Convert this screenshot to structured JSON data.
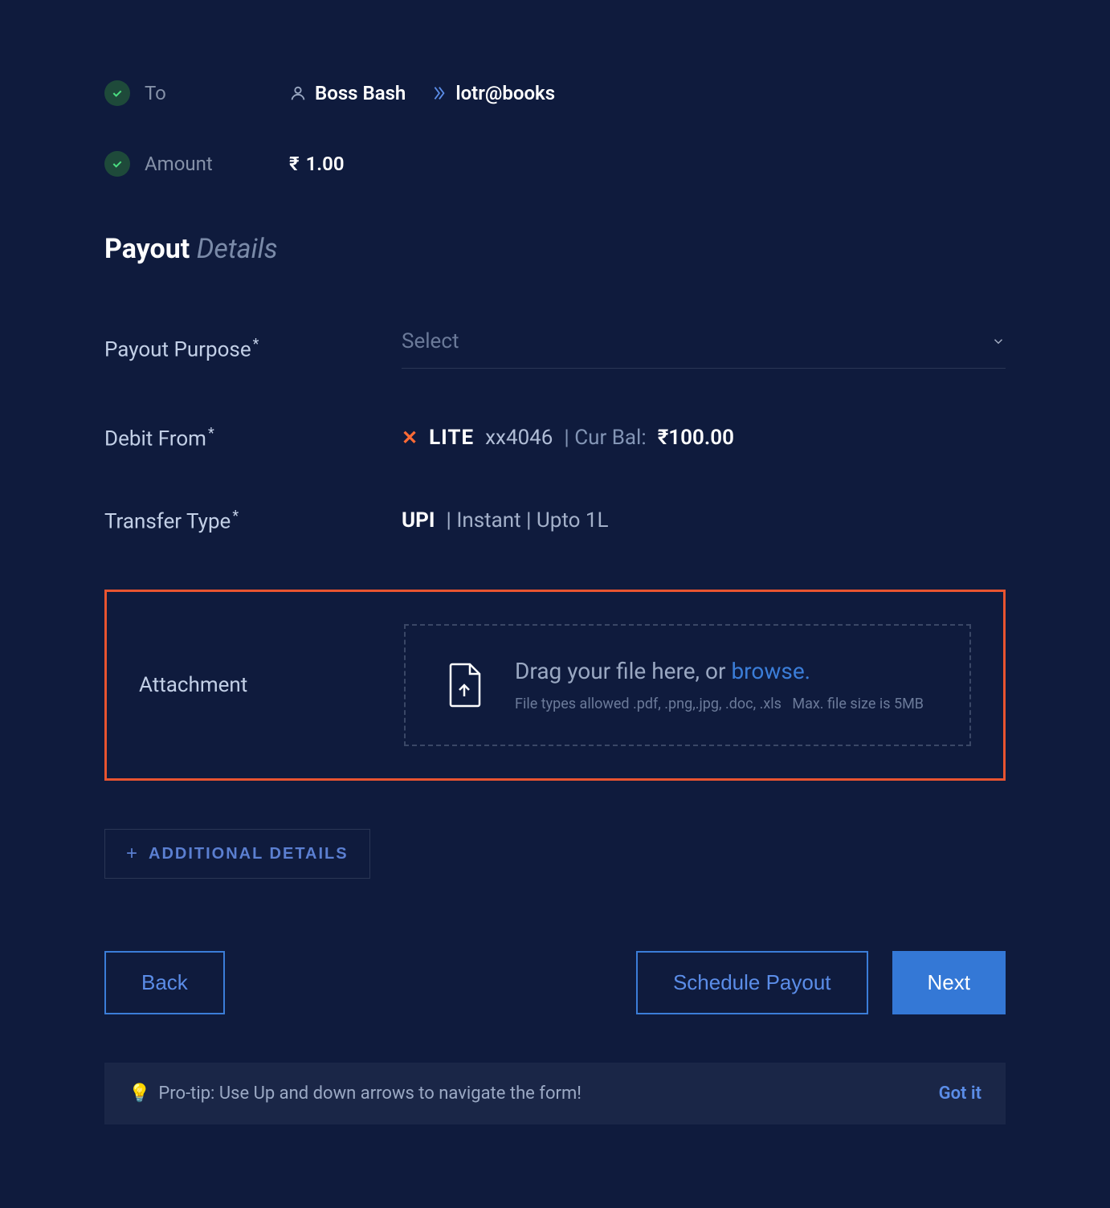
{
  "summary": {
    "to_label": "To",
    "recipient_name": "Boss Bash",
    "recipient_upi": "lotr@books",
    "amount_label": "Amount",
    "amount_currency": "₹",
    "amount_value": "1.00"
  },
  "section": {
    "title_bold": "Payout",
    "title_light": "Details"
  },
  "form": {
    "purpose_label": "Payout Purpose",
    "purpose_placeholder": "Select",
    "debit_label": "Debit From",
    "debit_lite": "LITE",
    "debit_account": "xx4046",
    "debit_balance_label": "| Cur Bal:",
    "debit_balance_value": "₹100.00",
    "transfer_label": "Transfer Type",
    "transfer_method": "UPI",
    "transfer_details": "| Instant | Upto 1L"
  },
  "attachment": {
    "label": "Attachment",
    "drag_text": "Drag your file here, or",
    "browse": "browse.",
    "file_types": "File types allowed .pdf, .png,.jpg, .doc, .xls",
    "max_size": "Max. file size is 5MB"
  },
  "buttons": {
    "additional": "ADDITIONAL DETAILS",
    "back": "Back",
    "schedule": "Schedule Payout",
    "next": "Next"
  },
  "protip": {
    "text": "Pro-tip: Use Up and down arrows to navigate the form!",
    "got_it": "Got it"
  }
}
